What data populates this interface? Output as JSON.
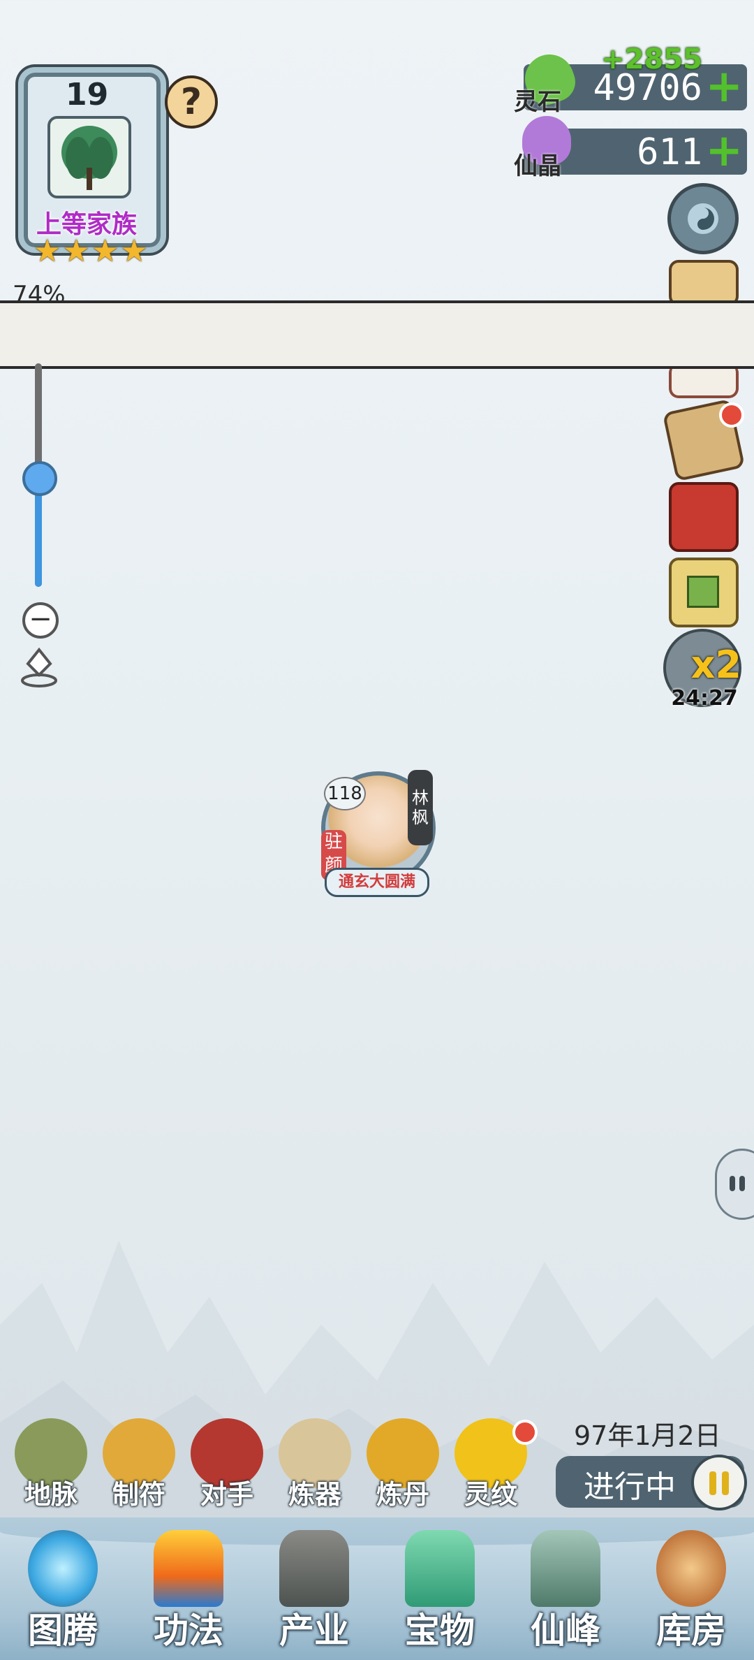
{
  "family": {
    "level": "19",
    "rank": "上等家族",
    "stars": [
      "★",
      "★",
      "★",
      "★"
    ],
    "help": "?"
  },
  "resources": {
    "spirit_stone": {
      "name": "灵石",
      "value": "49706",
      "gain": "+2855",
      "plus": "+"
    },
    "crystal": {
      "name": "仙晶",
      "value": "611",
      "plus": "+"
    }
  },
  "progress": {
    "percent": "74%"
  },
  "speed": {
    "multiplier": "x2",
    "timer": "24:27"
  },
  "character": {
    "level": "118",
    "name": "林枫",
    "tag": "驻颜",
    "realm": "通玄大圆满"
  },
  "zoom": {
    "level": 0.5,
    "zoom_out": "−"
  },
  "actions": [
    "地脉",
    "制符",
    "对手",
    "炼器",
    "炼丹",
    "灵纹"
  ],
  "date": "97年1月2日",
  "status": {
    "text": "进行中"
  },
  "nav": [
    "图腾",
    "功法",
    "产业",
    "宝物",
    "仙峰",
    "库房"
  ],
  "colors": {
    "accent_green": "#53c12b",
    "panel": "#4f6470",
    "rank_purple": "#b02bc6",
    "realm_red": "#d33c3c"
  }
}
